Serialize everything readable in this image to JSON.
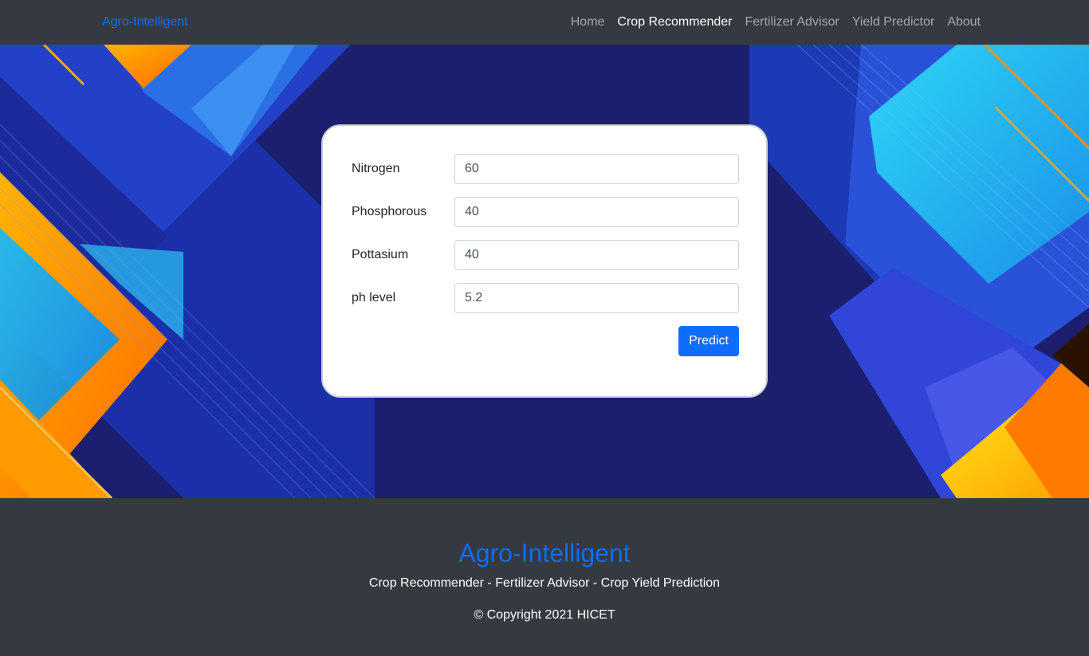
{
  "navbar": {
    "brand": "Agro-Intelligent",
    "links": [
      {
        "label": "Home"
      },
      {
        "label": "Crop Recommender"
      },
      {
        "label": "Fertilizer Advisor"
      },
      {
        "label": "Yield Predictor"
      },
      {
        "label": "About"
      }
    ],
    "active_index": 1
  },
  "form": {
    "fields": [
      {
        "label": "Nitrogen",
        "value": "60"
      },
      {
        "label": "Phosphorous",
        "value": "40"
      },
      {
        "label": "Pottasium",
        "value": "40"
      },
      {
        "label": "ph level",
        "value": "5.2"
      }
    ],
    "submit_label": "Predict"
  },
  "footer": {
    "title": "Agro-Intelligent",
    "tagline": "Crop Recommender - Fertilizer Advisor - Crop Yield Prediction",
    "copyright": "© Copyright 2021 HICET"
  },
  "colors": {
    "navbar_bg": "#343a40",
    "brand": "#0d6efd",
    "hero_bg": "#1b1f6e",
    "button": "#0d6efd"
  }
}
